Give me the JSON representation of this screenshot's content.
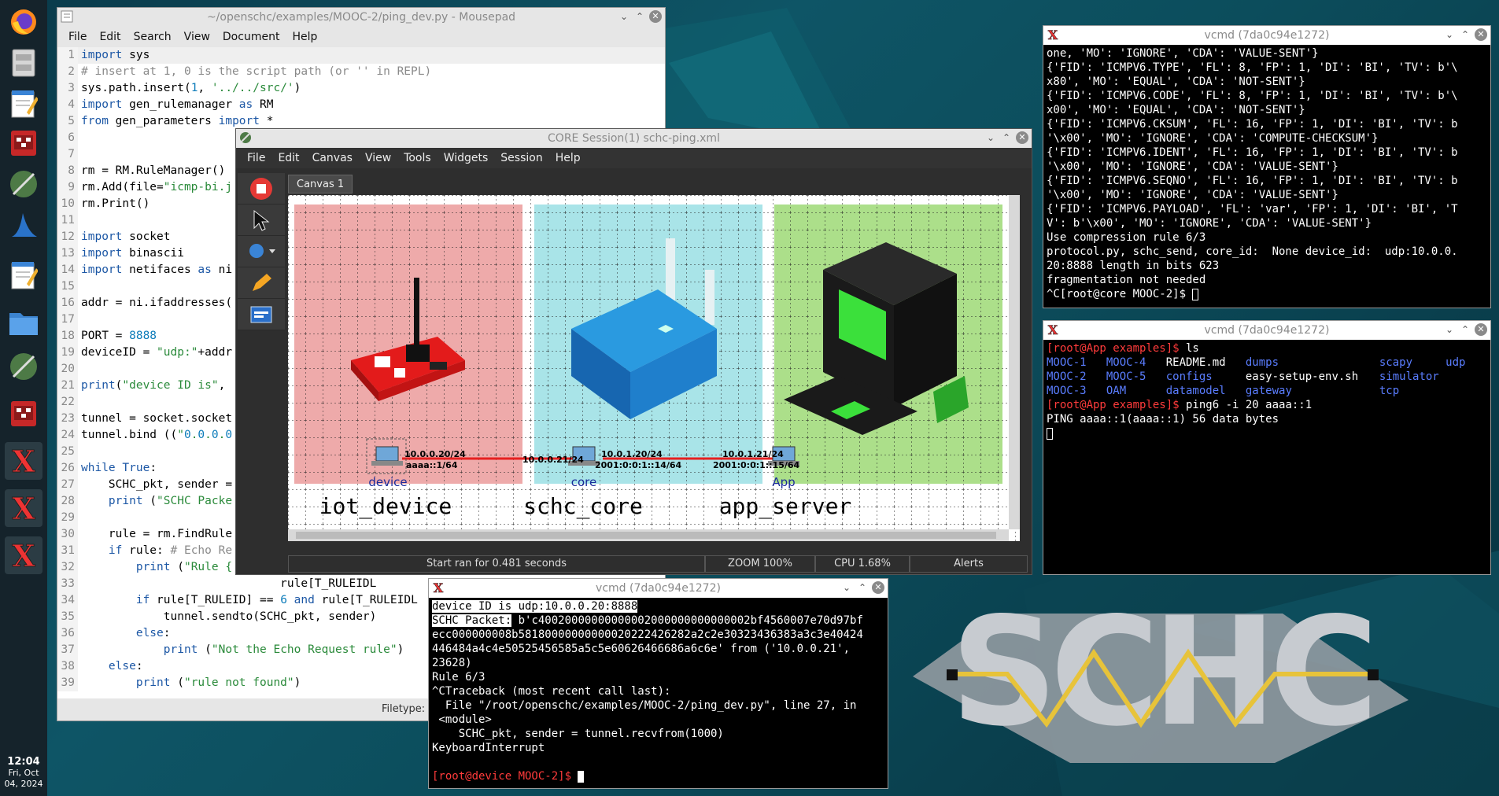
{
  "taskbar": {
    "clock_time": "12:04",
    "clock_day": "Fri, Oct",
    "clock_date": "04, 2024",
    "apps": [
      "firefox-icon",
      "file-cabinet-icon",
      "text-editor-icon",
      "core-gui-icon",
      "network-icon",
      "wireshark-icon",
      "text-editor-icon",
      "folder-icon",
      "network-icon",
      "core-gui-icon",
      "xterm-icon",
      "xterm-icon",
      "xterm-icon"
    ]
  },
  "mousepad": {
    "title": "~/openschc/examples/MOOC-2/ping_dev.py - Mousepad",
    "menu": [
      "File",
      "Edit",
      "Search",
      "View",
      "Document",
      "Help"
    ],
    "status_filetype": "Filetype:",
    "lines": [
      {
        "n": "1",
        "t": "import sys"
      },
      {
        "n": "2",
        "t": "# insert at 1, 0 is the script path (or '' in REPL)"
      },
      {
        "n": "3",
        "t": "sys.path.insert(1, '../../src/')"
      },
      {
        "n": "4",
        "t": "import gen_rulemanager as RM"
      },
      {
        "n": "5",
        "t": "from gen_parameters import *"
      },
      {
        "n": "6",
        "t": ""
      },
      {
        "n": "7",
        "t": ""
      },
      {
        "n": "8",
        "t": "rm = RM.RuleManager()"
      },
      {
        "n": "9",
        "t": "rm.Add(file=\"icmp-bi.j"
      },
      {
        "n": "10",
        "t": "rm.Print()"
      },
      {
        "n": "11",
        "t": ""
      },
      {
        "n": "12",
        "t": "import socket"
      },
      {
        "n": "13",
        "t": "import binascii"
      },
      {
        "n": "14",
        "t": "import netifaces as ni"
      },
      {
        "n": "15",
        "t": ""
      },
      {
        "n": "16",
        "t": "addr = ni.ifaddresses("
      },
      {
        "n": "17",
        "t": ""
      },
      {
        "n": "18",
        "t": "PORT = 8888"
      },
      {
        "n": "19",
        "t": "deviceID = \"udp:\"+addr"
      },
      {
        "n": "20",
        "t": ""
      },
      {
        "n": "21",
        "t": "print(\"device ID is\","
      },
      {
        "n": "22",
        "t": ""
      },
      {
        "n": "23",
        "t": "tunnel = socket.socket"
      },
      {
        "n": "24",
        "t": "tunnel.bind ((\"0.0.0.0"
      },
      {
        "n": "25",
        "t": ""
      },
      {
        "n": "26",
        "t": "while True:"
      },
      {
        "n": "27",
        "t": "    SCHC_pkt, sender ="
      },
      {
        "n": "28",
        "t": "    print (\"SCHC Packe"
      },
      {
        "n": "29",
        "t": ""
      },
      {
        "n": "30",
        "t": "    rule = rm.FindRule"
      },
      {
        "n": "31",
        "t": "    if rule: # Echo Re"
      },
      {
        "n": "32",
        "t": "        print (\"Rule {"
      },
      {
        "n": "33",
        "t": "                             rule[T_RULEIDL"
      },
      {
        "n": "34",
        "t": "        if rule[T_RULEID] == 6 and rule[T_RULEIDL"
      },
      {
        "n": "35",
        "t": "            tunnel.sendto(SCHC_pkt, sender)"
      },
      {
        "n": "36",
        "t": "        else:"
      },
      {
        "n": "37",
        "t": "            print (\"Not the Echo Request rule\")"
      },
      {
        "n": "38",
        "t": "    else:"
      },
      {
        "n": "39",
        "t": "        print (\"rule not found\")"
      }
    ]
  },
  "core": {
    "title": "CORE Session(1) schc-ping.xml",
    "menu": [
      "File",
      "Edit",
      "Canvas",
      "View",
      "Tools",
      "Widgets",
      "Session",
      "Help"
    ],
    "canvas_tab": "Canvas 1",
    "status_msg": "Start ran for 0.481 seconds",
    "status_zoom": "ZOOM 100%",
    "status_cpu": "CPU 1.68%",
    "status_alerts": "Alerts",
    "zones": [
      {
        "label": "iot_device",
        "color": "#eeaaaa"
      },
      {
        "label": "schc_core",
        "color": "#a9e4e8"
      },
      {
        "label": "app_server",
        "color": "#acdf8a"
      }
    ],
    "nodes": [
      {
        "name": "device",
        "addr1": "10.0.0.20/24",
        "addr2": "aaaa::1/64"
      },
      {
        "name": "core",
        "addr_left": "10.0.0.21/24",
        "addr1": "10.0.1.20/24",
        "addr2": "2001:0:0:1::14/64"
      },
      {
        "name": "App",
        "addr1": "10.0.1.21/24",
        "addr2": "2001:0:0:1::15/64"
      }
    ]
  },
  "term_core": {
    "title": "vcmd (7da0c94e1272)",
    "lines": [
      "one, 'MO': 'IGNORE', 'CDA': 'VALUE-SENT'}",
      "{'FID': 'ICMPV6.TYPE', 'FL': 8, 'FP': 1, 'DI': 'BI', 'TV': b'\\",
      "x80', 'MO': 'EQUAL', 'CDA': 'NOT-SENT'}",
      "{'FID': 'ICMPV6.CODE', 'FL': 8, 'FP': 1, 'DI': 'BI', 'TV': b'\\",
      "x00', 'MO': 'EQUAL', 'CDA': 'NOT-SENT'}",
      "{'FID': 'ICMPV6.CKSUM', 'FL': 16, 'FP': 1, 'DI': 'BI', 'TV': b",
      "'\\x00', 'MO': 'IGNORE', 'CDA': 'COMPUTE-CHECKSUM'}",
      "{'FID': 'ICMPV6.IDENT', 'FL': 16, 'FP': 1, 'DI': 'BI', 'TV': b",
      "'\\x00', 'MO': 'IGNORE', 'CDA': 'VALUE-SENT'}",
      "{'FID': 'ICMPV6.SEQNO', 'FL': 16, 'FP': 1, 'DI': 'BI', 'TV': b",
      "'\\x00', 'MO': 'IGNORE', 'CDA': 'VALUE-SENT'}",
      "{'FID': 'ICMPV6.PAYLOAD', 'FL': 'var', 'FP': 1, 'DI': 'BI', 'T",
      "V': b'\\x00', 'MO': 'IGNORE', 'CDA': 'VALUE-SENT'}",
      "Use compression rule 6/3",
      "protocol.py, schc_send, core_id:  None device_id:  udp:10.0.0.",
      "20:8888 length in bits 623",
      "fragmentation not needed"
    ],
    "prompt": "^C[root@core MOOC-2]$ "
  },
  "term_app": {
    "title": "vcmd (7da0c94e1272)",
    "prompt1": "[root@App examples]$",
    "cmd1": " ls",
    "ls_rows": [
      [
        {
          "t": "MOOC-1",
          "c": "blue"
        },
        {
          "t": "MOOC-4",
          "c": "blue"
        },
        {
          "t": "README.md",
          "c": "white"
        },
        {
          "t": "dumps",
          "c": "blue"
        },
        {
          "t": "",
          "c": "white"
        },
        {
          "t": "scapy",
          "c": "blue"
        },
        {
          "t": "udp",
          "c": "blue"
        }
      ],
      [
        {
          "t": "MOOC-2",
          "c": "blue"
        },
        {
          "t": "MOOC-5",
          "c": "blue"
        },
        {
          "t": "configs",
          "c": "blue"
        },
        {
          "t": "easy-setup-env.sh",
          "c": "white"
        },
        {
          "t": "",
          "c": "white"
        },
        {
          "t": "simulator",
          "c": "blue"
        },
        {
          "t": "",
          "c": "white"
        }
      ],
      [
        {
          "t": "MOOC-3",
          "c": "blue"
        },
        {
          "t": "OAM",
          "c": "blue"
        },
        {
          "t": "datamodel",
          "c": "blue"
        },
        {
          "t": "gateway",
          "c": "blue"
        },
        {
          "t": "",
          "c": "white"
        },
        {
          "t": "tcp",
          "c": "blue"
        },
        {
          "t": "",
          "c": "white"
        }
      ]
    ],
    "prompt2": "[root@App examples]$",
    "cmd2": " ping6 -i 20 aaaa::1",
    "out": "PING aaaa::1(aaaa::1) 56 data bytes"
  },
  "term_device": {
    "title": "vcmd (7da0c94e1272)",
    "line_devid": "device ID is udp:10.0.0.20:8888",
    "line_pkt_label": "SCHC Packet:",
    "line_pkt_rest": " b'c40020000000000002000000000000002bf4560007e70d97bf",
    "lines": [
      "ecc000000008b58180000000000020222426282a2c2e30323436383a3c3e40424",
      "446484a4c4e50525456585a5c5e60626466686a6c6e' from ('10.0.0.21',",
      "23628)",
      "Rule 6/3",
      "^CTraceback (most recent call last):",
      "  File \"/root/openschc/examples/MOOC-2/ping_dev.py\", line 27, in",
      " <module>",
      "    SCHC_pkt, sender = tunnel.recvfrom(1000)",
      "KeyboardInterrupt",
      ""
    ],
    "prompt": "[root@device MOOC-2]$ "
  },
  "logo": {
    "text": "SCHC"
  }
}
